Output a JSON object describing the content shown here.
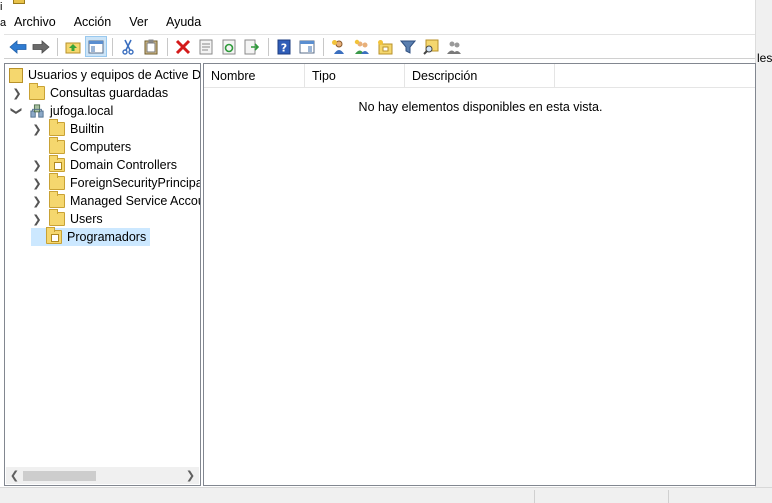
{
  "menu": [
    "Archivo",
    "Acción",
    "Ver",
    "Ayuda"
  ],
  "toolbar": {
    "buttons": [
      {
        "name": "back-arrow-icon"
      },
      {
        "name": "forward-arrow-icon"
      },
      {
        "name": "up-folder-icon"
      },
      {
        "name": "show-console-tree-icon",
        "active": true
      },
      {
        "name": "cut-icon"
      },
      {
        "name": "paste-icon"
      },
      {
        "name": "delete-icon"
      },
      {
        "name": "properties-icon"
      },
      {
        "name": "refresh-icon"
      },
      {
        "name": "export-list-icon"
      },
      {
        "name": "help-icon"
      },
      {
        "name": "show-action-pane-icon"
      },
      {
        "name": "new-user-icon"
      },
      {
        "name": "new-group-icon"
      },
      {
        "name": "new-ou-icon"
      },
      {
        "name": "filter-icon"
      },
      {
        "name": "find-icon"
      },
      {
        "name": "add-to-group-icon"
      }
    ]
  },
  "tree": {
    "root": "Usuarios y equipos de Active Directory",
    "saved_queries": "Consultas guardadas",
    "domain": "jufoga.local",
    "children": [
      {
        "label": "Builtin",
        "expandable": true,
        "ou": false
      },
      {
        "label": "Computers",
        "expandable": false,
        "ou": false
      },
      {
        "label": "Domain Controllers",
        "expandable": true,
        "ou": true
      },
      {
        "label": "ForeignSecurityPrincipals",
        "expandable": true,
        "ou": false
      },
      {
        "label": "Managed Service Accounts",
        "expandable": true,
        "ou": false
      },
      {
        "label": "Users",
        "expandable": true,
        "ou": false
      },
      {
        "label": "Programadors",
        "expandable": false,
        "ou": true,
        "selected": true
      }
    ]
  },
  "list": {
    "columns": [
      "Nombre",
      "Tipo",
      "Descripción"
    ],
    "empty_message": "No hay elementos disponibles en esta vista."
  },
  "right_edge_text": "les",
  "left_edge_text": [
    "i",
    "a"
  ]
}
